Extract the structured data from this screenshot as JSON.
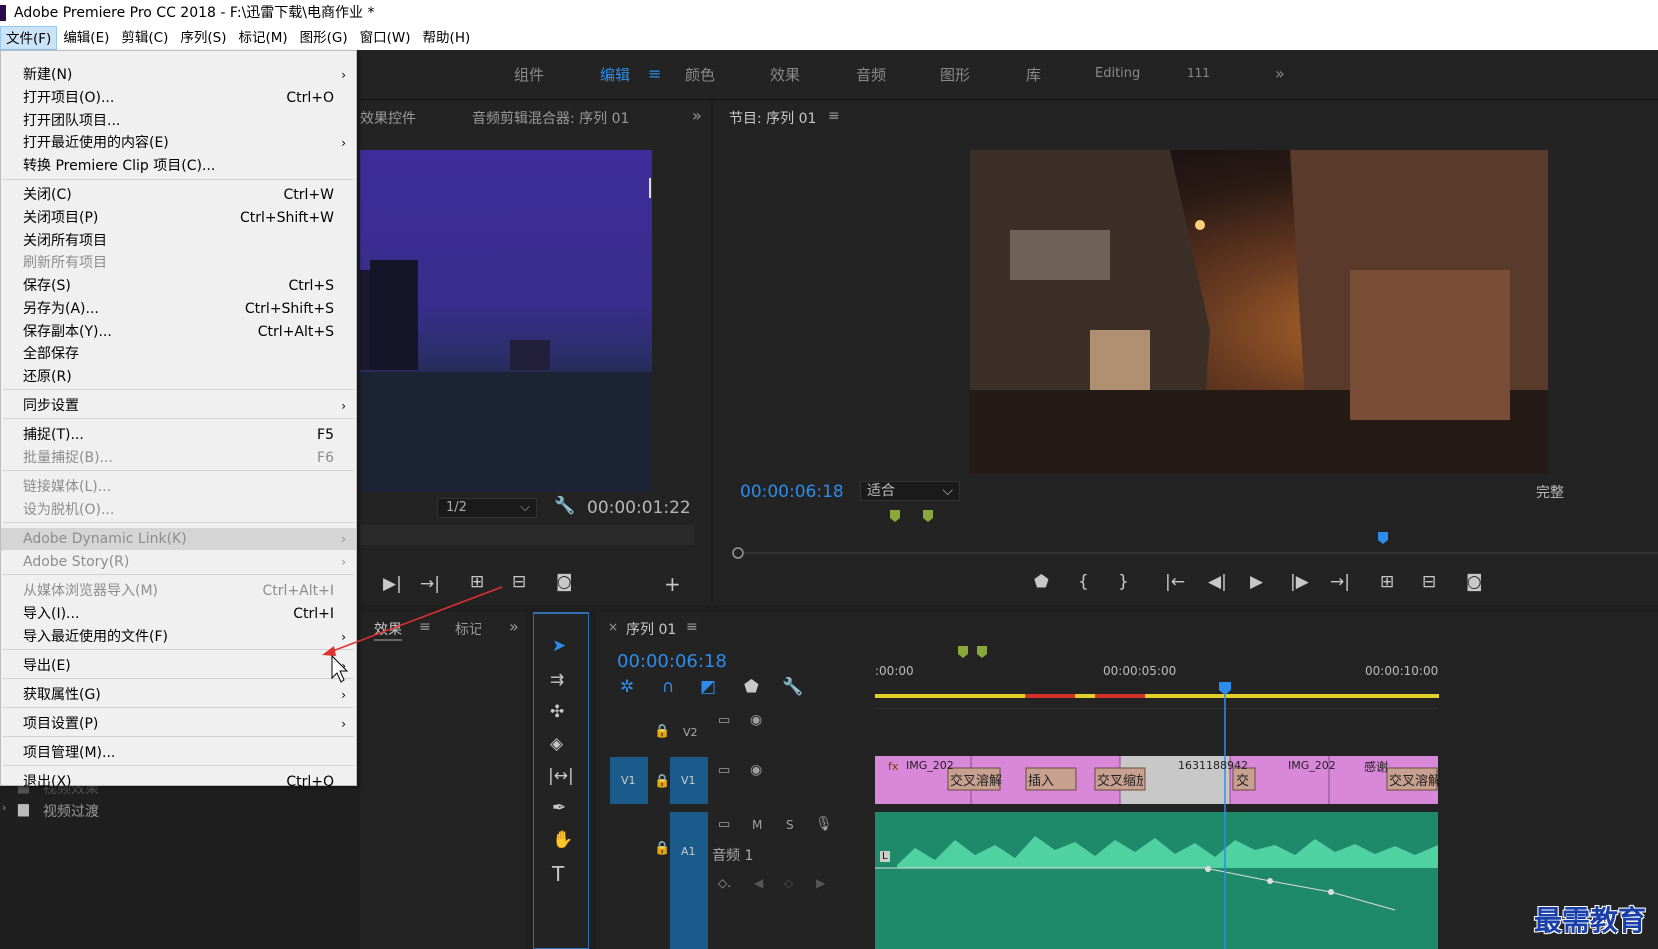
{
  "window": {
    "title": "Adobe Premiere Pro CC 2018 - F:\\迅雷下载\\电商作业 *"
  },
  "menubar": [
    "文件(F)",
    "编辑(E)",
    "剪辑(C)",
    "序列(S)",
    "标记(M)",
    "图形(G)",
    "窗口(W)",
    "帮助(H)"
  ],
  "file_menu": [
    {
      "label": "新建(N)",
      "shortcut": "",
      "submenu": true,
      "disabled": false
    },
    {
      "label": "打开项目(O)...",
      "shortcut": "Ctrl+O",
      "submenu": false,
      "disabled": false
    },
    {
      "label": "打开团队项目...",
      "shortcut": "",
      "submenu": false,
      "disabled": false
    },
    {
      "label": "打开最近使用的内容(E)",
      "shortcut": "",
      "submenu": true,
      "disabled": false
    },
    {
      "label": "转换 Premiere Clip 项目(C)...",
      "shortcut": "",
      "submenu": false,
      "disabled": false
    },
    {
      "label": "关闭(C)",
      "shortcut": "Ctrl+W",
      "submenu": false,
      "disabled": false
    },
    {
      "label": "关闭项目(P)",
      "shortcut": "Ctrl+Shift+W",
      "submenu": false,
      "disabled": false
    },
    {
      "label": "关闭所有项目",
      "shortcut": "",
      "submenu": false,
      "disabled": false
    },
    {
      "label": "刷新所有项目",
      "shortcut": "",
      "submenu": false,
      "disabled": true
    },
    {
      "label": "保存(S)",
      "shortcut": "Ctrl+S",
      "submenu": false,
      "disabled": false
    },
    {
      "label": "另存为(A)...",
      "shortcut": "Ctrl+Shift+S",
      "submenu": false,
      "disabled": false
    },
    {
      "label": "保存副本(Y)...",
      "shortcut": "Ctrl+Alt+S",
      "submenu": false,
      "disabled": false
    },
    {
      "label": "全部保存",
      "shortcut": "",
      "submenu": false,
      "disabled": false
    },
    {
      "label": "还原(R)",
      "shortcut": "",
      "submenu": false,
      "disabled": false
    },
    {
      "label": "同步设置",
      "shortcut": "",
      "submenu": true,
      "disabled": false
    },
    {
      "label": "捕捉(T)...",
      "shortcut": "F5",
      "submenu": false,
      "disabled": false
    },
    {
      "label": "批量捕捉(B)...",
      "shortcut": "F6",
      "submenu": false,
      "disabled": true
    },
    {
      "label": "链接媒体(L)...",
      "shortcut": "",
      "submenu": false,
      "disabled": true
    },
    {
      "label": "设为脱机(O)...",
      "shortcut": "",
      "submenu": false,
      "disabled": true
    },
    {
      "label": "Adobe Dynamic Link(K)",
      "shortcut": "",
      "submenu": true,
      "disabled": true
    },
    {
      "label": "Adobe Story(R)",
      "shortcut": "",
      "submenu": true,
      "disabled": true
    },
    {
      "label": "从媒体浏览器导入(M)",
      "shortcut": "Ctrl+Alt+I",
      "submenu": false,
      "disabled": true
    },
    {
      "label": "导入(I)...",
      "shortcut": "Ctrl+I",
      "submenu": false,
      "disabled": false
    },
    {
      "label": "导入最近使用的文件(F)",
      "shortcut": "",
      "submenu": true,
      "disabled": false
    },
    {
      "label": "导出(E)",
      "shortcut": "",
      "submenu": true,
      "disabled": false
    },
    {
      "label": "获取属性(G)",
      "shortcut": "",
      "submenu": true,
      "disabled": false
    },
    {
      "label": "项目设置(P)",
      "shortcut": "",
      "submenu": true,
      "disabled": false
    },
    {
      "label": "项目管理(M)...",
      "shortcut": "",
      "submenu": false,
      "disabled": false
    },
    {
      "label": "退出(X)",
      "shortcut": "Ctrl+Q",
      "submenu": false,
      "disabled": false
    }
  ],
  "workspaces": [
    "组件",
    "编辑",
    "颜色",
    "效果",
    "音频",
    "图形",
    "库",
    "Editing",
    "111"
  ],
  "source_monitor": {
    "tab1": "效果控件",
    "tab2": "音频剪辑混合器: 序列 01",
    "zoom": "1/2",
    "timecode": "00:00:01:22"
  },
  "program_monitor": {
    "title": "节目: 序列 01",
    "timecode": "00:00:06:18",
    "fit": "适合",
    "quality": "完整"
  },
  "effects_panel": {
    "tab1": "效果",
    "tab2": "标记",
    "items": [
      "视频效果",
      "视频过渡"
    ]
  },
  "timeline": {
    "sequence": "序列 01",
    "timecode": "00:00:06:18",
    "ruler": [
      ":00:00",
      "00:00:05:00",
      "00:00:10:00"
    ],
    "tracks": {
      "v2": "V2",
      "v1": "V1",
      "a1": "A1",
      "audio_name": "音频 1",
      "m": "M",
      "s": "S"
    },
    "clips": [
      "IMG_202",
      "交叉溶解",
      "插入",
      "交叉缩放",
      "1631188942",
      "交",
      "IMG_202",
      "感谢",
      "交叉溶解"
    ],
    "audio_label": "L",
    "fx": "fx"
  },
  "watermark": "最需教育",
  "colors": {
    "accent": "#2d8ceb",
    "clip_pink": "#d98ad9",
    "audio_green": "#1f8a6a"
  }
}
